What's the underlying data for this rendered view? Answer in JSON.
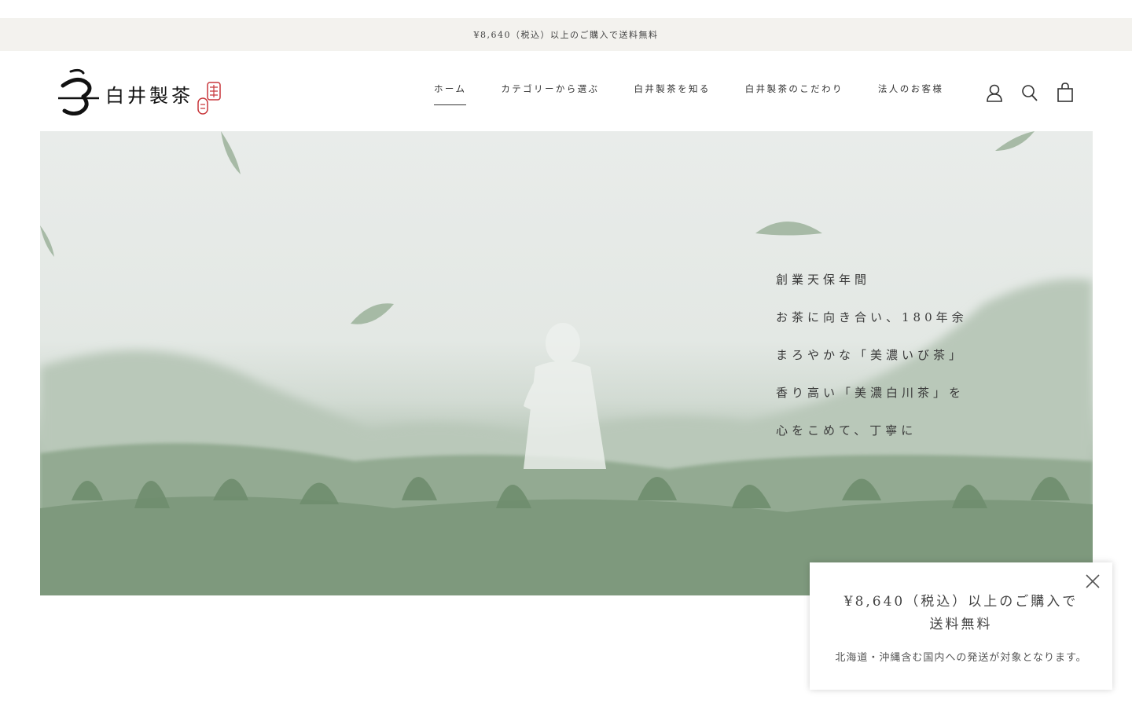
{
  "announcement": {
    "text": "¥8,640（税込）以上のご購入で送料無料"
  },
  "brand": {
    "name": "白井製茶",
    "logo_icon": "tea-leaf-logo-icon",
    "seal_icon": "red-seal-stamp-icon"
  },
  "nav": {
    "items": [
      {
        "label": "ホーム",
        "active": true
      },
      {
        "label": "カテゴリーから選ぶ",
        "active": false
      },
      {
        "label": "白井製茶を知る",
        "active": false
      },
      {
        "label": "白井製茶のこだわり",
        "active": false
      },
      {
        "label": "法人のお客様",
        "active": false
      }
    ]
  },
  "header_icons": {
    "account": "user-icon",
    "search": "search-icon",
    "cart": "shopping-bag-icon"
  },
  "hero": {
    "lines": [
      "創業天保年間",
      "お茶に向き合い、180年余",
      "まろやかな「美濃いび茶」",
      "香り高い「美濃白川茶」を",
      "心をこめて、丁寧に"
    ]
  },
  "popup": {
    "title_line1": "¥8,640（税込）以上のご購入で",
    "title_line2": "送料無料",
    "note": "北海道・沖縄含む国内への発送が対象となります。",
    "close_icon": "close-icon"
  },
  "colors": {
    "announcement_bg": "#f3f2ee",
    "seal_red": "#c8373b",
    "leaf_green": "#7d9a7a"
  }
}
